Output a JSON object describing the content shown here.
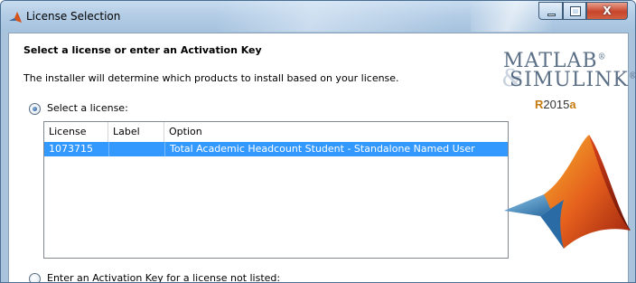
{
  "window": {
    "title": "License Selection"
  },
  "controls": {
    "close_glyph": "X"
  },
  "content": {
    "heading": "Select a license or enter an Activation Key",
    "description": "The installer will determine which products to install based on your license.",
    "select_license_label": "Select a license:",
    "select_license_checked": true,
    "activation_key_label": "Enter an Activation Key for a license not listed:",
    "activation_key_checked": false
  },
  "table": {
    "columns": [
      "License",
      "Label",
      "Option"
    ],
    "rows": [
      {
        "license": "1073715",
        "label": "",
        "option": "Total Academic Headcount Student - Standalone Named User",
        "selected": true
      }
    ]
  },
  "brand": {
    "line1": "MATLAB",
    "line2": "SIMULINK",
    "amp": "&",
    "reg_mark": "®",
    "release_r": "R",
    "release_year": "2015",
    "release_suffix": "a"
  },
  "colors": {
    "selection": "#3399ff",
    "titlebar": "#b4cde6",
    "brand_text": "#5a6f86",
    "release_accent": "#c77a10",
    "close_button": "#c8452c"
  },
  "icons": {
    "app": "matlab-membrane-icon",
    "minimize": "minimize-icon",
    "maximize": "maximize-icon",
    "close": "close-icon"
  }
}
